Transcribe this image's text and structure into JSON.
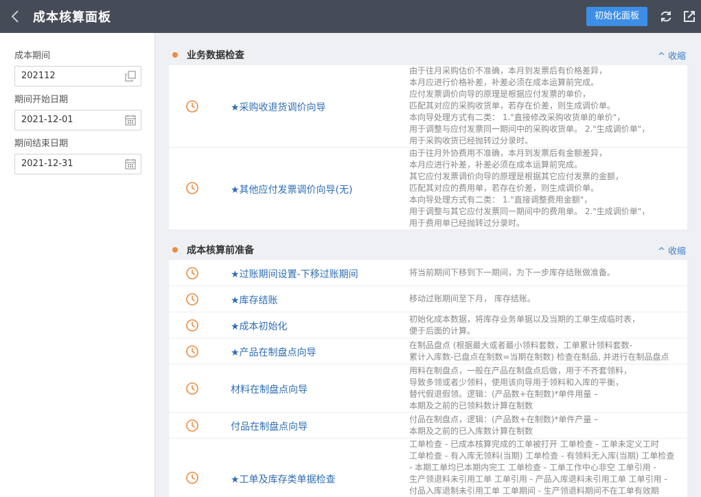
{
  "header": {
    "title": "成本核算面板",
    "init_button": "初始化面板",
    "back_icon": "chevron-left-icon",
    "refresh_icon": "refresh-icon",
    "export_icon": "external-link-icon"
  },
  "sidebar": {
    "period_label": "成本期间",
    "period_value": "202112",
    "start_label": "期间开始日期",
    "start_value": "2021-12-01",
    "end_label": "期间结束日期",
    "end_value": "2021-12-31"
  },
  "colors": {
    "accent": "#3d8ee6",
    "link": "#2e6db4",
    "icon": "#f08a3c",
    "topbar": "#464c57"
  },
  "sections": [
    {
      "title": "业务数据检查",
      "collapse": "^ 收缩",
      "rows": [
        {
          "name": "★采购收退货调价向导",
          "desc": [
            "由于往月采购估价不准确，本月到发票后有价格差异，",
            "本月应进行价格补差，补差必须在成本运算前完成。",
            "应付发票调价向导的原理是根据应付发票的单价，",
            "匹配其对应的采购收货单，若存在价差，则生成调价单。",
            "本向导处理方式有二类： 1.\"直接修改采购收货单的单价\"，",
            "用于调整与应付发票同一期间中的采购收货单。 2.\"生成调价单\"，",
            "用于采购收货已经抛转过分录时。"
          ]
        },
        {
          "name": "★其他应付发票调价向导(无)",
          "desc": [
            "由于往月外协费用不准确，本月到发票后有金额差异，",
            "本月应进行补差，补差必须在成本运算前完成。",
            "其它应付发票调价向导的原理是根据其它应付发票的金额，",
            "匹配其对应的费用单，若存在价差，则生成调价单。",
            "本向导处理方式有二类： 1.\"直接调整费用金额\"，",
            "用于调整与其它应付发票同一期间中的费用单。 2.\"生成调价单\"，",
            "用于费用单已经抛转过分录时。"
          ]
        }
      ]
    },
    {
      "title": "成本核算前准备",
      "collapse": "^ 收缩",
      "rows": [
        {
          "name": "★过账期间设置-下移过账期间",
          "desc": [
            "将当前期间下移到下一期间，为下一步库存结账做准备。"
          ]
        },
        {
          "name": "★库存结账",
          "desc": [
            "移动过账期间至下月， 库存结账。"
          ]
        },
        {
          "name": "★成本初始化",
          "desc": [
            "初始化成本数据，将库存业务单据以及当期的工单生成临时表，",
            "便于后面的计算。"
          ]
        },
        {
          "name": "★产品在制盘点向导",
          "desc": [
            "在制品盘点 (根据最大或者最小领料套数，工单累计领料套数-",
            "累计入库数-已盘点在制数=当期在制数) 检查在制品, 并进行在制品盘点"
          ]
        },
        {
          "name": "材料在制盘点向导",
          "desc": [
            "用料在制盘点，一般在产品在制盘点后做，用于不齐套领料，",
            "导致多领或者少领料，使用该向导用于领料和入库的平衡，",
            "替代假退假领。逻辑：(产品数+在制数)*单件用量 –",
            "本期及之前的已领料数计算在制数"
          ]
        },
        {
          "name": "付品在制盘点向导",
          "desc": [
            "付品在制盘点，逻辑：(产品数+在制数)*单件产量 –",
            "本期及之前的已入库数计算在制数"
          ]
        },
        {
          "name": "★工单及库存类单据检查",
          "desc": [
            "工单检查 - 已成本核算完成的工单被打开 工单检查 - 工单未定义工时",
            "工单检查 - 有入库无领料(当期) 工单检查 - 有领料无入库(当期) 工单检查",
            "- 本期工单均已本期内完工 工单检查 - 工单工作中心非空 工单引用 -",
            "生产领退料未引用工单 工单引用 - 产品入库退料未引用工单 工单引用 -",
            "付品入库退制未引用工单 工单期间 - 生产领退料期间不在工单有效期"
          ]
        }
      ]
    }
  ]
}
